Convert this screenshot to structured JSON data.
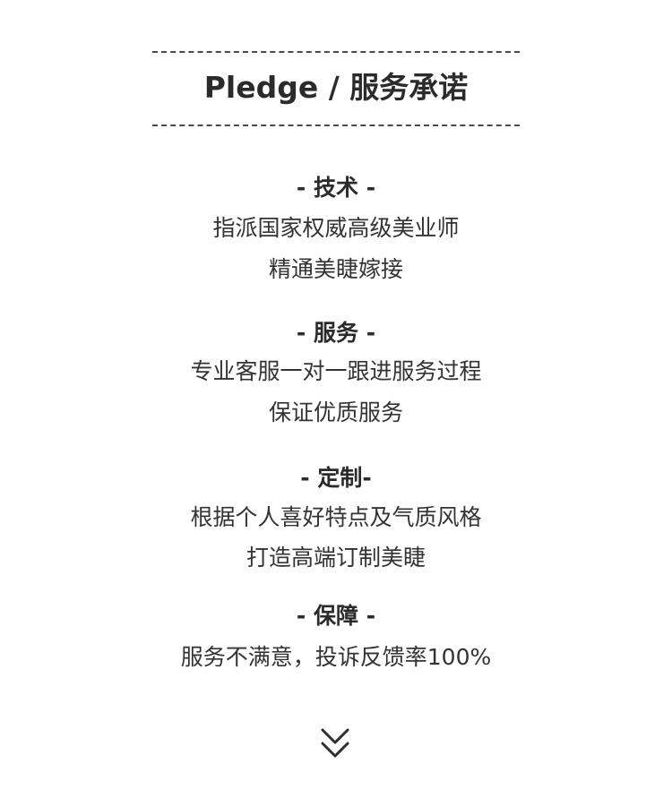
{
  "header": {
    "title": "Pledge / 服务承诺"
  },
  "sections": [
    {
      "heading": "- 技术 -",
      "lines": [
        "指派国家权威高级美业师",
        "精通美睫嫁接"
      ]
    },
    {
      "heading": "- 服务 -",
      "lines": [
        "专业客服一对一跟进服务过程",
        "保证优质服务"
      ]
    },
    {
      "heading": "- 定制-",
      "lines": [
        "根据个人喜好特点及气质风格",
        "打造高端订制美睫"
      ]
    },
    {
      "heading": "- 保障 -",
      "lines": [
        "服务不满意，投诉反馈率100%"
      ]
    }
  ],
  "icons": {
    "scroll_down": "double-chevron-down-icon"
  },
  "colors": {
    "text": "#2e2e2e",
    "dash": "#4a4a4a",
    "background": "#ffffff"
  }
}
